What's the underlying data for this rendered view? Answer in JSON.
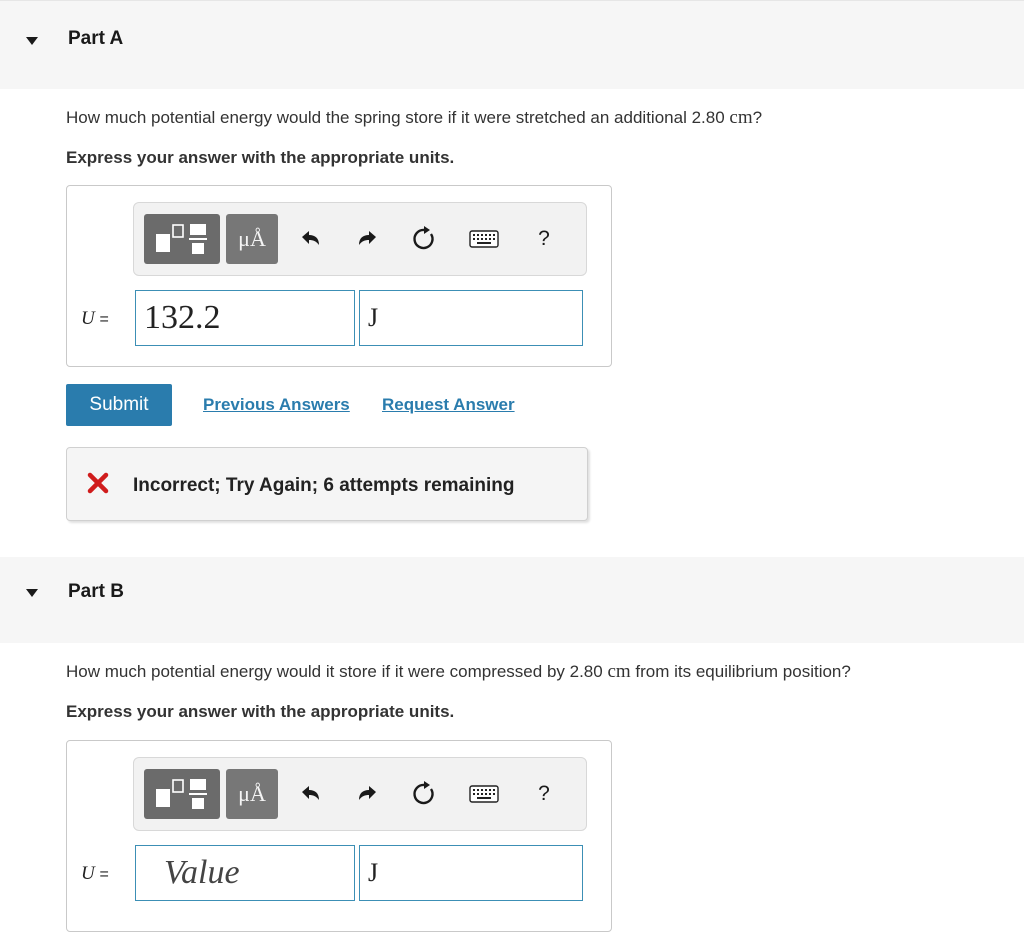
{
  "colors": {
    "accent": "#2a7cad",
    "error": "#d01c1c",
    "header_bg": "#f6f6f6"
  },
  "part_a": {
    "title": "Part A",
    "question_text": "How much potential energy would the spring store if it were stretched an additional 2.80",
    "question_unit": "cm",
    "question_end": "?",
    "instruction": "Express your answer with the appropriate units.",
    "toolbar": {
      "units_glyph": "μÅ",
      "help_glyph": "?",
      "icons": [
        "templates-icon",
        "units-icon",
        "undo-icon",
        "redo-icon",
        "reset-icon",
        "keyboard-icon",
        "help-icon"
      ]
    },
    "variable": "U",
    "equals": "=",
    "value": "132.2",
    "unit_value": "J",
    "submit_label": "Submit",
    "previous_answers_label": "Previous Answers",
    "request_answer_label": "Request Answer",
    "feedback": "Incorrect; Try Again; 6 attempts remaining"
  },
  "part_b": {
    "title": "Part B",
    "question_text": "How much potential energy would it store if it were compressed by 2.80",
    "question_unit": "cm",
    "question_end": "from its equilibrium position?",
    "instruction": "Express your answer with the appropriate units.",
    "toolbar": {
      "units_glyph": "μÅ",
      "help_glyph": "?"
    },
    "variable": "U",
    "equals": "=",
    "value_placeholder": "Value",
    "unit_value": "J"
  }
}
